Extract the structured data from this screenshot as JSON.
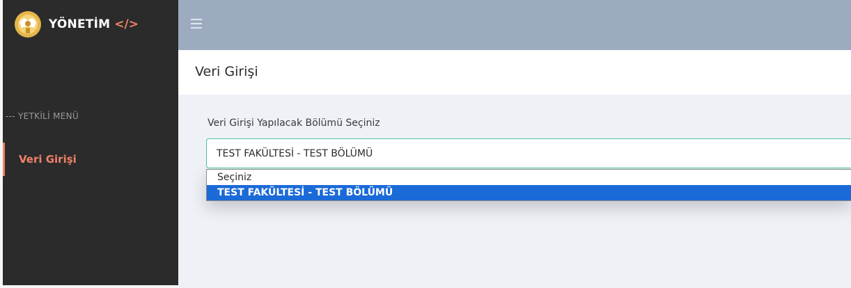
{
  "sidebar": {
    "brand": {
      "title": "YÖNETİM",
      "code_tag": "</>"
    },
    "menu_caption": "--- YETKİLİ MENÜ",
    "items": [
      {
        "label": "Veri Girişi",
        "active": true
      }
    ]
  },
  "topbar": {
    "menu_icon": "hamburger-icon"
  },
  "page": {
    "title": "Veri Girişi"
  },
  "form": {
    "label": "Veri Girişi Yapılacak Bölümü Seçiniz",
    "selected_value": "TEST FAKÜLTESİ - TEST BÖLÜMÜ",
    "options": [
      "Seçiniz",
      "TEST FAKÜLTESİ - TEST BÖLÜMÜ"
    ],
    "highlighted_option": 1
  },
  "colors": {
    "sidebar_bg": "#2b2b2b",
    "accent": "#f0826a",
    "topbar_bg": "#9dabc1",
    "content_bg": "#eef1f6",
    "select_border": "#4fc1a0",
    "option_highlight": "#1a6ad8"
  }
}
